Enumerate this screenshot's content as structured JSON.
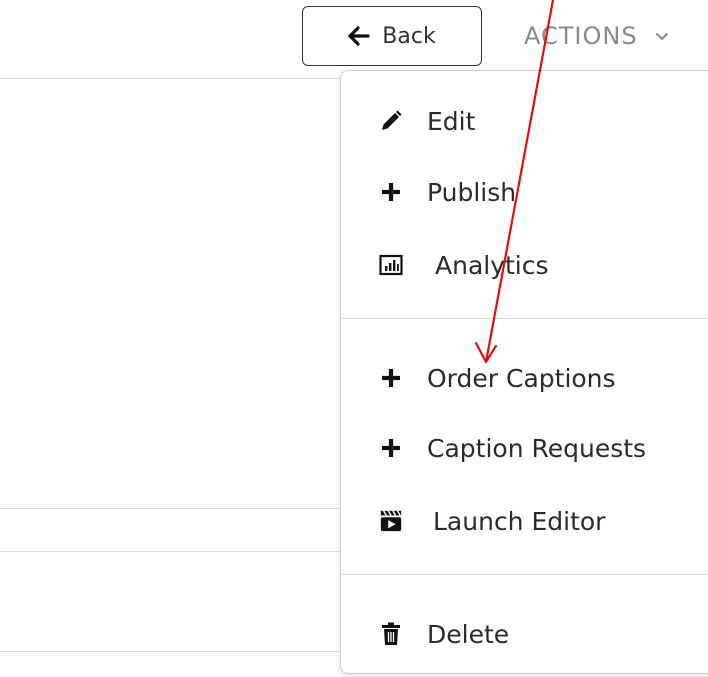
{
  "header": {
    "back_label": "Back",
    "actions_label": "ACTIONS"
  },
  "menu": {
    "items": [
      {
        "label": "Edit",
        "icon": "pencil-icon"
      },
      {
        "label": "Publish",
        "icon": "plus-icon"
      },
      {
        "label": "Analytics",
        "icon": "analytics-icon"
      },
      {
        "label": "Order Captions",
        "icon": "plus-icon"
      },
      {
        "label": "Caption Requests",
        "icon": "plus-icon"
      },
      {
        "label": "Launch Editor",
        "icon": "clapperboard-icon"
      },
      {
        "label": "Delete",
        "icon": "trash-icon"
      }
    ]
  },
  "colors": {
    "annotation_arrow": "#e01010",
    "actions_text": "#8a8a8a",
    "border": "#cfcfcf"
  }
}
